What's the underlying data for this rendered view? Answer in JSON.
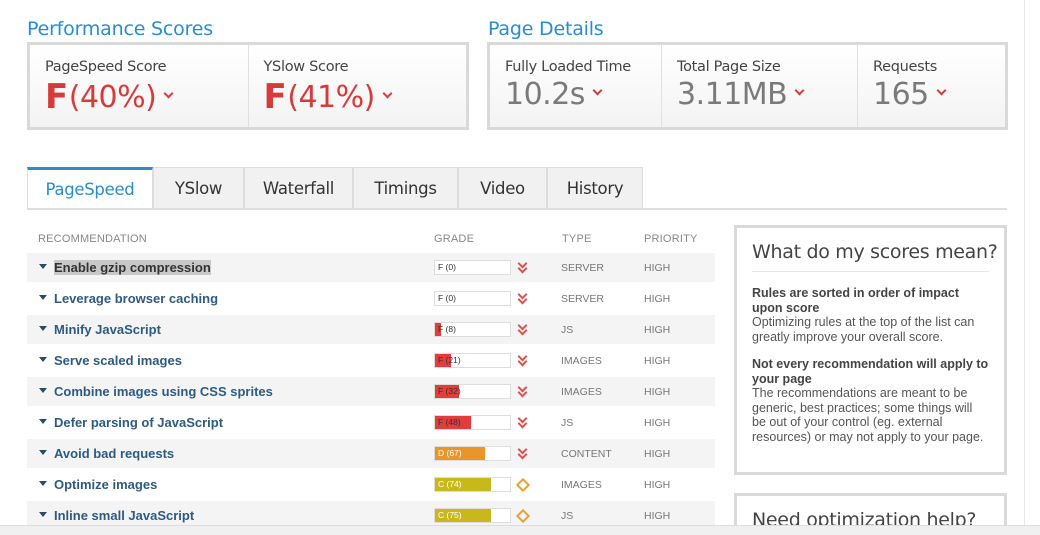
{
  "performance": {
    "title": "Performance Scores",
    "pagespeed": {
      "label": "PageSpeed Score",
      "grade": "F",
      "value": "(40%)"
    },
    "yslow": {
      "label": "YSlow Score",
      "grade": "F",
      "value": "(41%)"
    }
  },
  "details": {
    "title": "Page Details",
    "load_time": {
      "label": "Fully Loaded Time",
      "value": "10.2s"
    },
    "page_size": {
      "label": "Total Page Size",
      "value": "3.11MB"
    },
    "requests": {
      "label": "Requests",
      "value": "165"
    }
  },
  "tabs": [
    {
      "label": "PageSpeed"
    },
    {
      "label": "YSlow"
    },
    {
      "label": "Waterfall"
    },
    {
      "label": "Timings"
    },
    {
      "label": "Video"
    },
    {
      "label": "History"
    }
  ],
  "table": {
    "headers": {
      "recommendation": "RECOMMENDATION",
      "grade": "GRADE",
      "type": "TYPE",
      "priority": "PRIORITY"
    },
    "rows": [
      {
        "name": "Enable gzip compression",
        "grade": "F (0)",
        "score": 0,
        "type": "SERVER",
        "priority": "HIGH",
        "icon": "double-chevron-down-icon"
      },
      {
        "name": "Leverage browser caching",
        "grade": "F (0)",
        "score": 0,
        "type": "SERVER",
        "priority": "HIGH",
        "icon": "double-chevron-down-icon"
      },
      {
        "name": "Minify JavaScript",
        "grade": "F (8)",
        "score": 8,
        "type": "JS",
        "priority": "HIGH",
        "icon": "double-chevron-down-icon"
      },
      {
        "name": "Serve scaled images",
        "grade": "F (21)",
        "score": 21,
        "type": "IMAGES",
        "priority": "HIGH",
        "icon": "double-chevron-down-icon"
      },
      {
        "name": "Combine images using CSS sprites",
        "grade": "F (32)",
        "score": 32,
        "type": "IMAGES",
        "priority": "HIGH",
        "icon": "double-chevron-down-icon"
      },
      {
        "name": "Defer parsing of JavaScript",
        "grade": "F (48)",
        "score": 48,
        "type": "JS",
        "priority": "HIGH",
        "icon": "double-chevron-down-icon"
      },
      {
        "name": "Avoid bad requests",
        "grade": "D (67)",
        "score": 67,
        "type": "CONTENT",
        "priority": "HIGH",
        "icon": "double-chevron-down-icon"
      },
      {
        "name": "Optimize images",
        "grade": "C (74)",
        "score": 74,
        "type": "IMAGES",
        "priority": "HIGH",
        "icon": "diamond-icon"
      },
      {
        "name": "Inline small JavaScript",
        "grade": "C (75)",
        "score": 75,
        "type": "JS",
        "priority": "HIGH",
        "icon": "diamond-icon"
      }
    ]
  },
  "sidebar": {
    "title": "What do my scores mean?",
    "heading1": "Rules are sorted in order of impact upon score",
    "text1": "Optimizing rules at the top of the list can greatly improve your overall score.",
    "heading2": "Not every recommendation will apply to your page",
    "text2": "The recommendations are meant to be generic, best practices; some things will be out of your control (eg. external resources) or may not apply to your page.",
    "title2": "Need optimization help?"
  },
  "colors": {
    "accent": "#2a8ccf",
    "fail": "#d63b3b",
    "grade_f": "#e23d3d",
    "grade_d": "#e8962a",
    "grade_c": "#c9b81a"
  }
}
